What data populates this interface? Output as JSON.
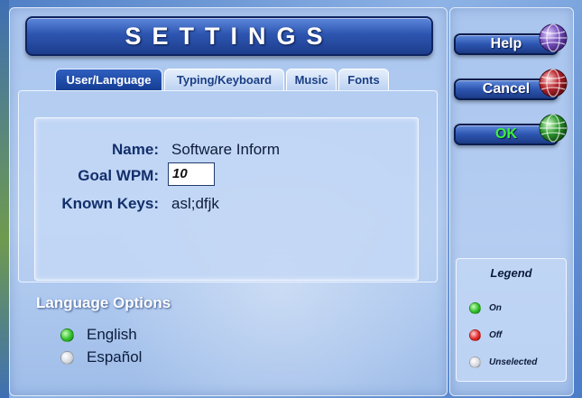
{
  "title": "SETTINGS",
  "tabs": [
    {
      "label": "User/Language",
      "active": true
    },
    {
      "label": "Typing/Keyboard",
      "active": false
    },
    {
      "label": "Music",
      "active": false
    },
    {
      "label": "Fonts",
      "active": false
    }
  ],
  "user": {
    "name_label": "Name:",
    "name_value": "Software Inform",
    "goal_label": "Goal WPM:",
    "goal_value": "10",
    "keys_label": "Known Keys:",
    "keys_value": "asl;dfjk"
  },
  "language": {
    "heading": "Language Options",
    "options": [
      {
        "label": "English",
        "state": "on"
      },
      {
        "label": "Español",
        "state": "unselected"
      }
    ]
  },
  "buttons": {
    "help": "Help",
    "cancel": "Cancel",
    "ok": "OK"
  },
  "legend": {
    "title": "Legend",
    "items": [
      {
        "label": "On",
        "color": "#2fbf2a"
      },
      {
        "label": "Off",
        "color": "#e32b2b"
      },
      {
        "label": "Unselected",
        "color": "#d7dbe2"
      }
    ]
  },
  "colors": {
    "accent": "#1d3d8d",
    "ok_text": "#3cf03c",
    "globe_help": "#7a55c0",
    "globe_cancel": "#b8262e",
    "globe_ok": "#2f9a2f"
  },
  "icons": {
    "help": "purple-globe-icon",
    "cancel": "red-globe-icon",
    "ok": "green-globe-icon"
  }
}
